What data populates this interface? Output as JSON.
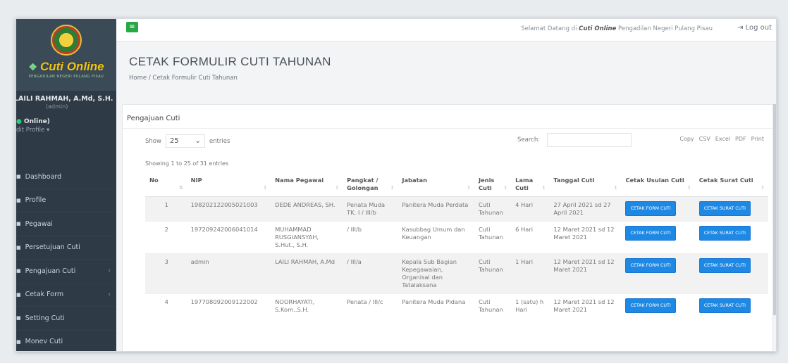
{
  "sidebar": {
    "brand_title": "Cuti Online",
    "brand_subtitle": "PENGADILAN NEGERI PULANG PISAU",
    "user_name": "LAILI RAHMAH, A.Md, S.H.",
    "user_role": "(admin)",
    "status": "Online)",
    "edit_profile": "dit Profile",
    "items": [
      {
        "label": "Dashboard",
        "has_submenu": false
      },
      {
        "label": "Profile",
        "has_submenu": false
      },
      {
        "label": "Pegawai",
        "has_submenu": false
      },
      {
        "label": "Persetujuan Cuti",
        "has_submenu": false
      },
      {
        "label": "Pengajuan Cuti",
        "has_submenu": true
      },
      {
        "label": "Cetak Form",
        "has_submenu": true
      },
      {
        "label": "Setting Cuti",
        "has_submenu": false
      },
      {
        "label": "Monev Cuti",
        "has_submenu": false
      }
    ]
  },
  "topbar": {
    "welcome_prefix": "Selamat Datang di ",
    "welcome_app": "Cuti Online",
    "welcome_suffix": " Pengadilan Negeri Pulang Pisau",
    "logout": "Log out"
  },
  "page": {
    "title": "CETAK FORMULIR CUTI TAHUNAN",
    "breadcrumb_home": "Home",
    "breadcrumb_sep": "/",
    "breadcrumb_current": "Cetak Formulir Cuti Tahunan"
  },
  "card": {
    "title": "Pengajuan Cuti",
    "show_label": "Show",
    "entries_value": "25",
    "entries_label": "entries",
    "search_label": "Search:",
    "search_value": "",
    "exports": [
      "Copy",
      "CSV",
      "Excel",
      "PDF",
      "Print"
    ],
    "info": "Showing 1 to 25 of 31 entries"
  },
  "table": {
    "headers": [
      "No",
      "NIP",
      "Nama Pegawai",
      "Pangkat / Golongan",
      "Jabatan",
      "Jenis Cuti",
      "Lama Cuti",
      "Tanggal Cuti",
      "Cetak Usulan Cuti",
      "Cetak Surat Cuti"
    ],
    "btn_form": "CETAK FORM CUTI",
    "btn_surat": "CETAK SURAT CUTI",
    "rows": [
      {
        "no": "1",
        "nip": "198202122005021003",
        "nama": "DEDE ANDREAS, SH.",
        "pangkat": "Penata Muda TK. I / III/b",
        "jabatan": "Panitera Muda Perdata",
        "jenis": "Cuti Tahunan",
        "lama": "4 Hari",
        "tanggal": "27 April 2021 sd 27 April 2021"
      },
      {
        "no": "2",
        "nip": "197209242006041014",
        "nama": "MUHAMMAD RUSGIANSYAH, S.Hut., S.H.",
        "pangkat": "/ III/b",
        "jabatan": "Kasubbag Umum dan Keuangan",
        "jenis": "Cuti Tahunan",
        "lama": "6 Hari",
        "tanggal": "12 Maret 2021 sd 12 Maret 2021"
      },
      {
        "no": "3",
        "nip": "admin",
        "nama": "LAILI RAHMAH, A.Md",
        "pangkat": "/ III/a",
        "jabatan": "Kepala Sub Bagian Kepegawaian, Organisai dan Tatalaksana",
        "jenis": "Cuti Tahunan",
        "lama": "1 Hari",
        "tanggal": "12 Maret 2021 sd 12 Maret 2021"
      },
      {
        "no": "4",
        "nip": "197708092009122002",
        "nama": "NOORHAYATI, S.Kom.,S.H.",
        "pangkat": "Penata / III/c",
        "jabatan": "Panitera Muda Pidana",
        "jenis": "Cuti Tahunan",
        "lama": "1 (satu) h Hari",
        "tanggal": "12 Maret 2021 sd 12 Maret 2021"
      }
    ]
  }
}
